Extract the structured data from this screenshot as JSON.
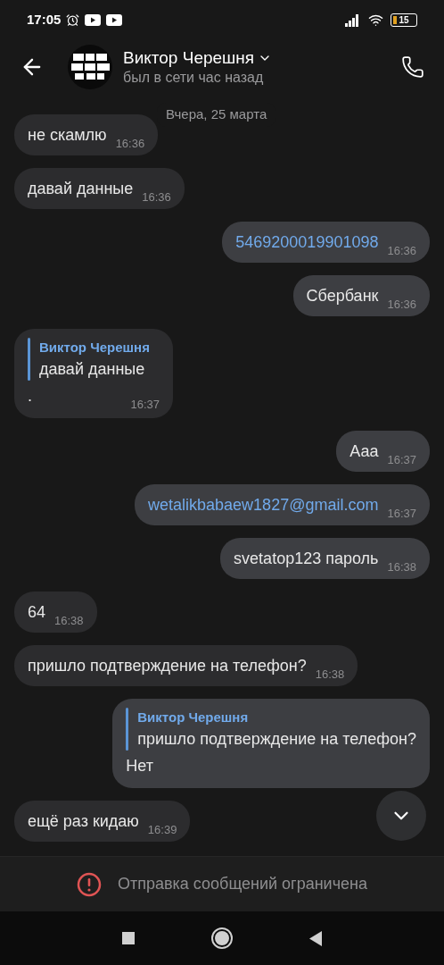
{
  "status_bar": {
    "time": "17:05",
    "battery": "15"
  },
  "header": {
    "name": "Виктор Черешня",
    "status": "был в сети час назад"
  },
  "date_label": "Вчера, 25 марта",
  "messages": [
    {
      "outgoing": false,
      "kind": "text",
      "text": "не скамлю",
      "time": "16:36"
    },
    {
      "outgoing": false,
      "kind": "text",
      "text": "давай данные",
      "time": "16:36"
    },
    {
      "outgoing": true,
      "kind": "link",
      "text": "5469200019901098",
      "time": "16:36"
    },
    {
      "outgoing": true,
      "kind": "text",
      "text": "Сбербанк",
      "time": "16:36"
    },
    {
      "outgoing": false,
      "kind": "reply",
      "reply_author": "Виктор Черешня",
      "reply_text": "давай данные",
      "text": ".",
      "time": "16:37"
    },
    {
      "outgoing": true,
      "kind": "text",
      "text": "Ааа",
      "time": "16:37"
    },
    {
      "outgoing": true,
      "kind": "link",
      "text": "wetalikbabaew1827@gmail.com",
      "time": "16:37"
    },
    {
      "outgoing": true,
      "kind": "text",
      "text": "svetatop123 пароль",
      "time": "16:38"
    },
    {
      "outgoing": false,
      "kind": "text",
      "text": "64",
      "time": "16:38"
    },
    {
      "outgoing": false,
      "kind": "text",
      "text": "пришло подтверждение на телефон?",
      "time": "16:38"
    },
    {
      "outgoing": true,
      "kind": "reply",
      "reply_author": "Виктор Черешня",
      "reply_text": "пришло подтверждение на телефон?",
      "text": "Нет"
    },
    {
      "outgoing": false,
      "kind": "text",
      "text": "ещё раз кидаю",
      "time": "16:39"
    }
  ],
  "restriction": "Отправка сообщений ограничена"
}
